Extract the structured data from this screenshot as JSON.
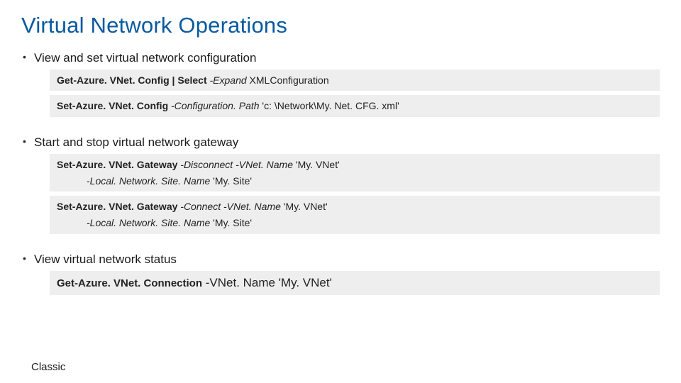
{
  "title": "Virtual Network Operations",
  "bullets": [
    {
      "label": "View and set virtual network configuration",
      "code": [
        {
          "bold": "Get-Azure. VNet. Config | Select",
          "italic": " -Expand",
          "rest": " XMLConfiguration"
        },
        {
          "bold": "Set-Azure. VNet. Config",
          "italic": " -Configuration. Path",
          "rest": " 'c: \\Network\\My. Net. CFG. xml'"
        }
      ]
    },
    {
      "label": "Start and stop virtual network gateway",
      "code": [
        {
          "bold": "Set-Azure. VNet. Gateway",
          "italic": " -Disconnect -VNet. Name",
          "rest": " 'My. VNet'",
          "cont_italic": "-Local. Network. Site. Name",
          "cont_rest": " 'My. Site'"
        },
        {
          "bold": "Set-Azure. VNet. Gateway",
          "italic": " -Connect -VNet. Name",
          "rest": " 'My. VNet'",
          "cont_italic": "-Local. Network. Site. Name",
          "cont_rest": " 'My. Site'"
        }
      ]
    },
    {
      "label": "View virtual network status",
      "code": [
        {
          "bold": "Get-Azure. VNet. Connection",
          "italic": " -VNet. Name ",
          "rest": "'My. VNet'",
          "big": true
        }
      ]
    }
  ],
  "footer": "Classic"
}
